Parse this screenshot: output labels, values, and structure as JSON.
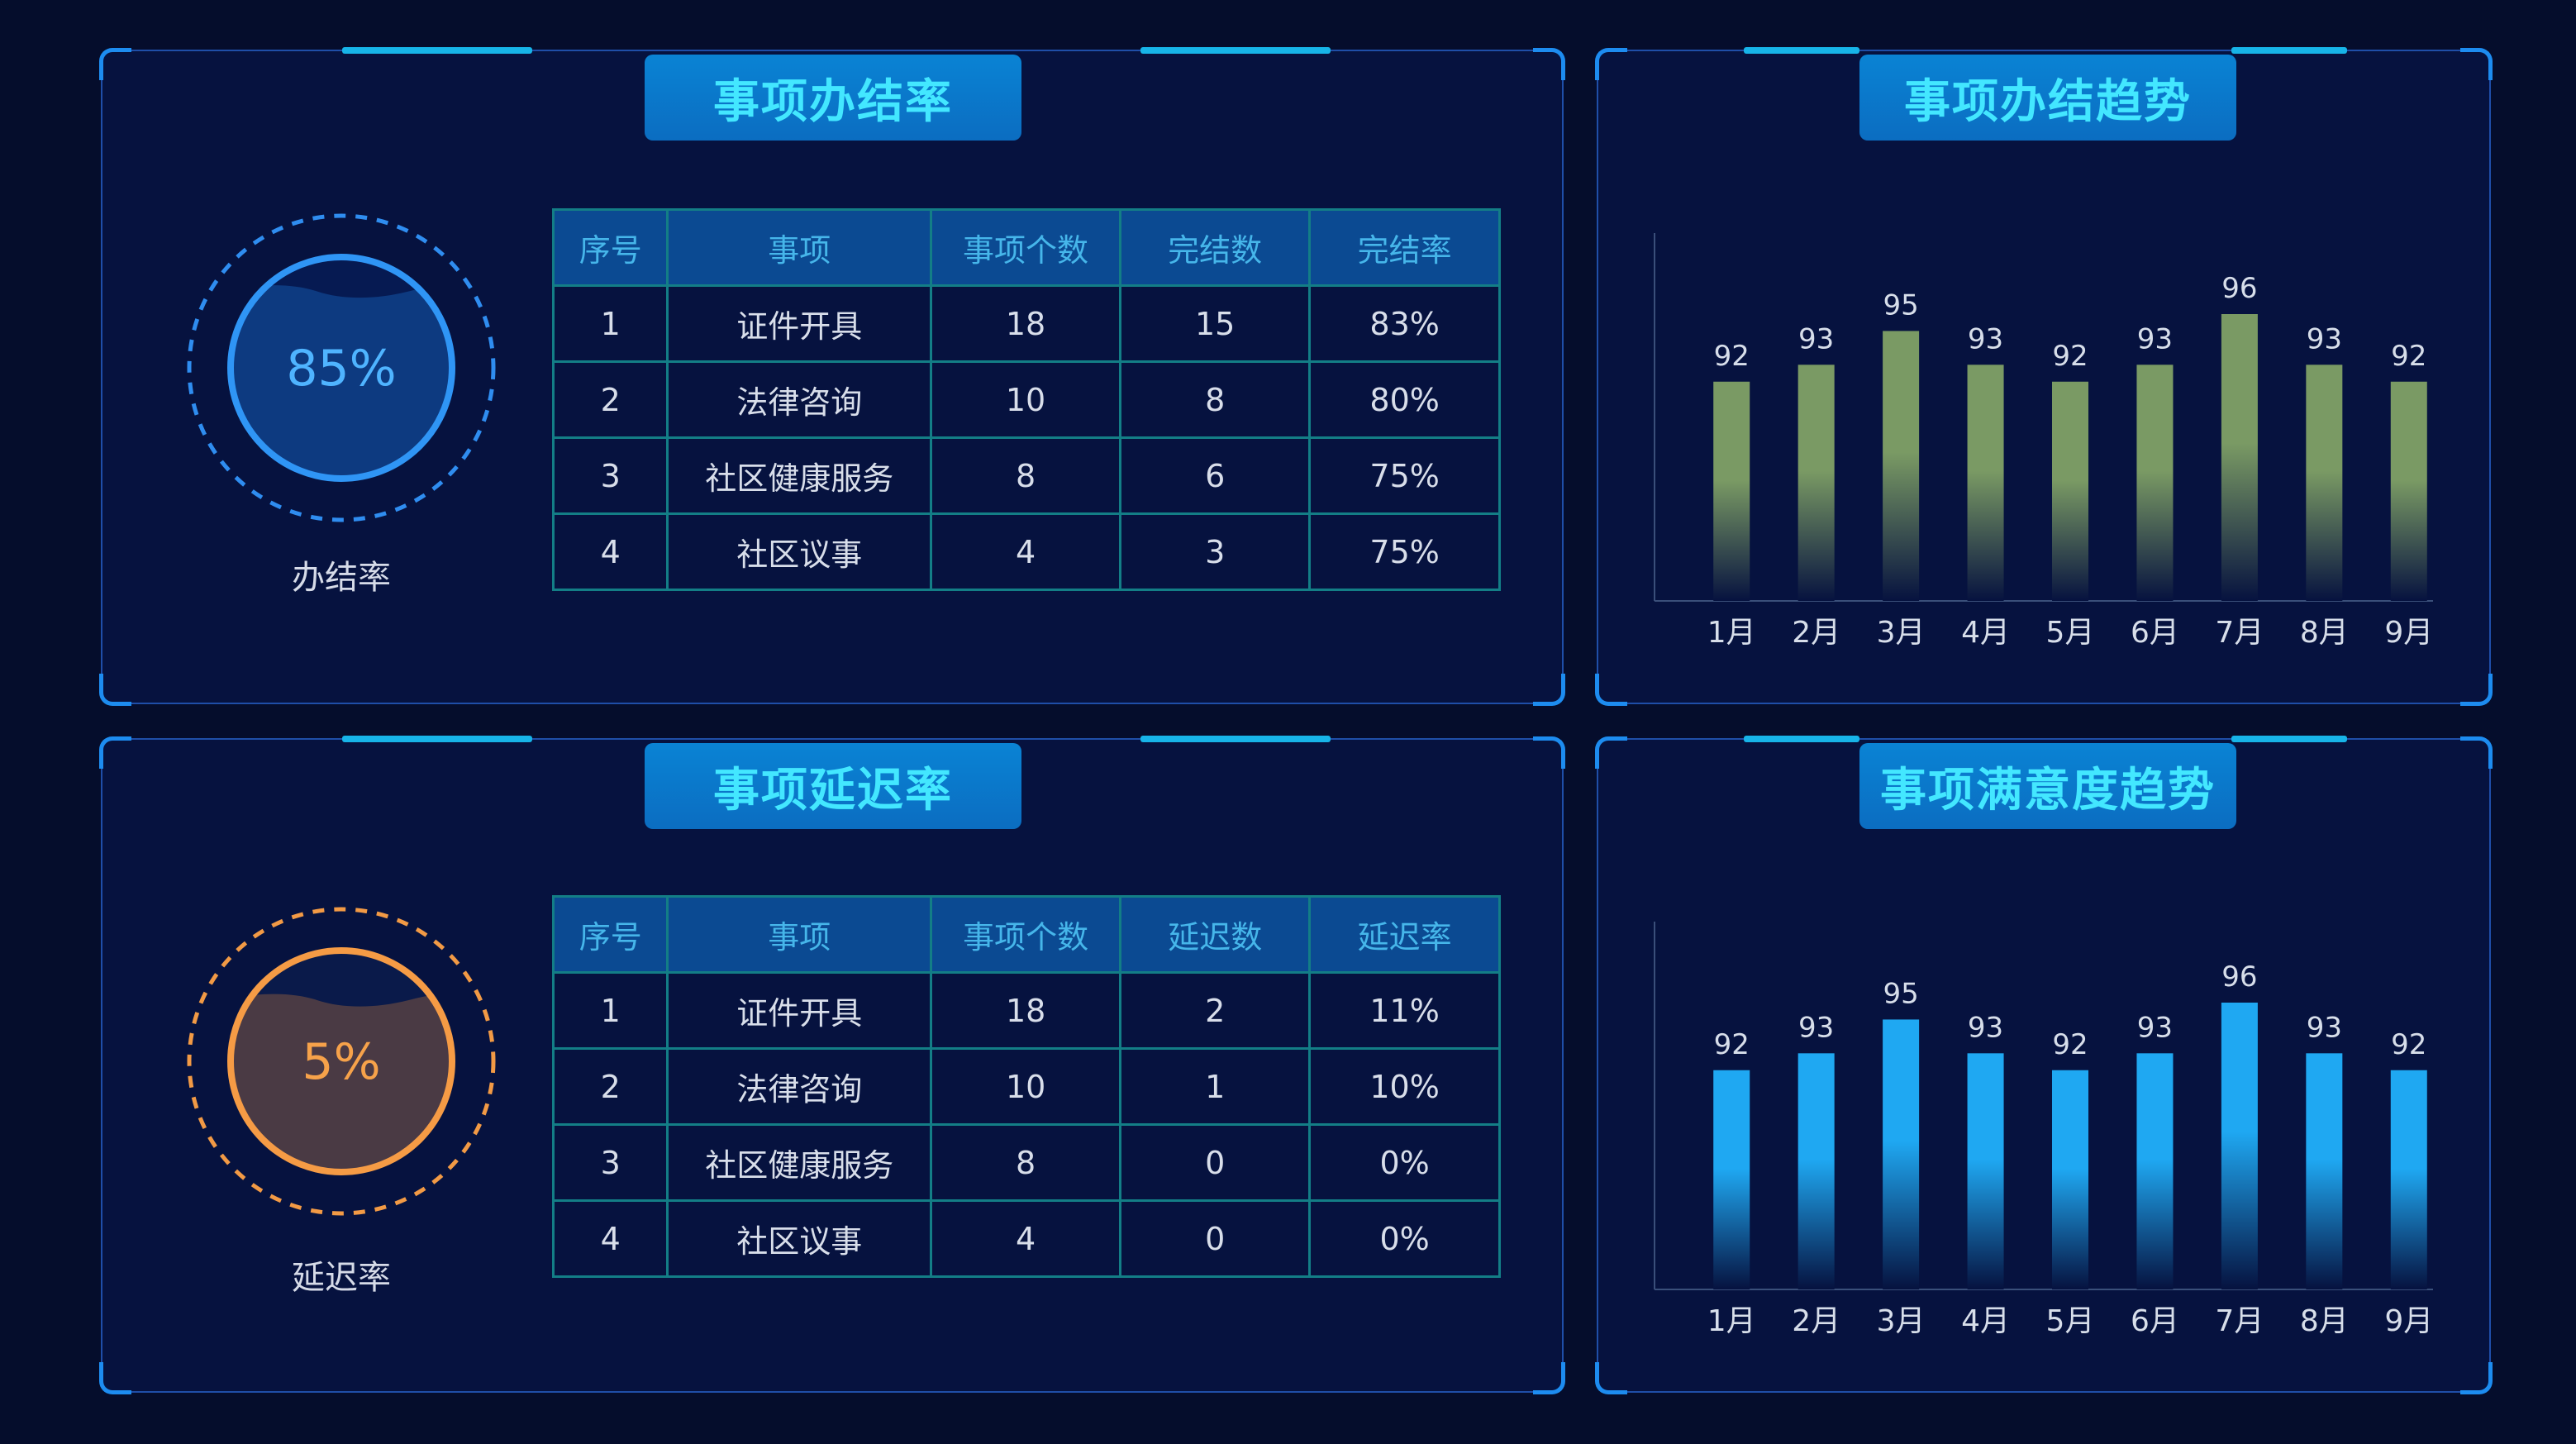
{
  "panels": {
    "completion_rate": {
      "title": "事项办结率",
      "gauge_value": "85%",
      "gauge_fraction": 0.85,
      "gauge_label": "办结率",
      "columns": [
        "序号",
        "事项",
        "事项个数",
        "完结数",
        "完结率"
      ],
      "rows": [
        [
          "1",
          "证件开具",
          "18",
          "15",
          "83%"
        ],
        [
          "2",
          "法律咨询",
          "10",
          "8",
          "80%"
        ],
        [
          "3",
          "社区健康服务",
          "8",
          "6",
          "75%"
        ],
        [
          "4",
          "社区议事",
          "4",
          "3",
          "75%"
        ]
      ]
    },
    "delay_rate": {
      "title": "事项延迟率",
      "gauge_value": "5%",
      "gauge_fraction": 0.05,
      "gauge_label": "延迟率",
      "columns": [
        "序号",
        "事项",
        "事项个数",
        "延迟数",
        "延迟率"
      ],
      "rows": [
        [
          "1",
          "证件开具",
          "18",
          "2",
          "11%"
        ],
        [
          "2",
          "法律咨询",
          "10",
          "1",
          "10%"
        ],
        [
          "3",
          "社区健康服务",
          "8",
          "0",
          "0%"
        ],
        [
          "4",
          "社区议事",
          "4",
          "0",
          "0%"
        ]
      ]
    },
    "completion_trend": {
      "title": "事项办结趋势"
    },
    "satisfaction_trend": {
      "title": "事项满意度趋势"
    }
  },
  "colors": {
    "completion_gauge": "#2f8df0",
    "delay_gauge": "#f29a45",
    "completion_bar": "#7a9a64",
    "satisfaction_bar": "#1fa8f2"
  },
  "chart_data": [
    {
      "type": "bar",
      "title": "事项办结趋势",
      "categories": [
        "1月",
        "2月",
        "3月",
        "4月",
        "5月",
        "6月",
        "7月",
        "8月",
        "9月"
      ],
      "values": [
        92,
        93,
        95,
        93,
        92,
        93,
        96,
        93,
        92
      ],
      "data_labels": true,
      "grid": false
    },
    {
      "type": "bar",
      "title": "事项满意度趋势",
      "categories": [
        "1月",
        "2月",
        "3月",
        "4月",
        "5月",
        "6月",
        "7月",
        "8月",
        "9月"
      ],
      "values": [
        92,
        93,
        95,
        93,
        92,
        93,
        96,
        93,
        92
      ],
      "data_labels": true,
      "grid": false
    }
  ]
}
